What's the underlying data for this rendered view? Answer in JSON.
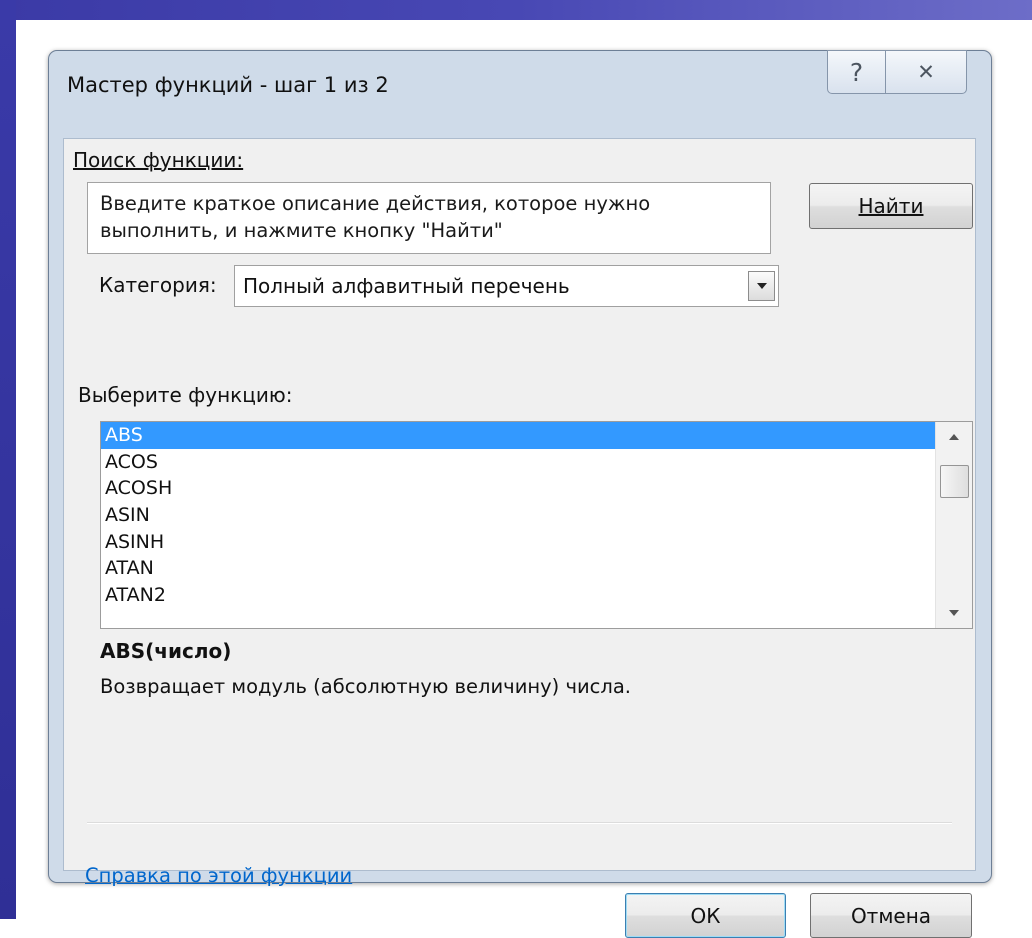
{
  "dialog": {
    "title": "Мастер функций - шаг 1 из 2",
    "help_icon": "question-mark-icon",
    "close_icon": "close-icon",
    "help_glyph": "?",
    "close_glyph": "✕"
  },
  "search": {
    "label": "Поиск функции:",
    "text_line1": "Введите краткое описание действия, которое нужно",
    "text_line2": "выполнить, и нажмите кнопку \"Найти\"",
    "find_button": "Найти"
  },
  "category": {
    "label": "Категория:",
    "selected": "Полный алфавитный перечень"
  },
  "functions": {
    "label": "Выберите функцию:",
    "items": [
      "ABS",
      "ACOS",
      "ACOSH",
      "ASIN",
      "ASINH",
      "ATAN",
      "ATAN2"
    ],
    "selected_index": 0
  },
  "details": {
    "signature": "ABS(число)",
    "description": "Возвращает модуль (абсолютную величину) числа."
  },
  "footer": {
    "help_link": "Справка по этой функции",
    "ok": "ОК",
    "cancel": "Отмена"
  },
  "colors": {
    "selection": "#3399ff",
    "link": "#0066cc",
    "dialog_frame": "#cfdbe9",
    "background_accent": "#3b3aa6"
  }
}
